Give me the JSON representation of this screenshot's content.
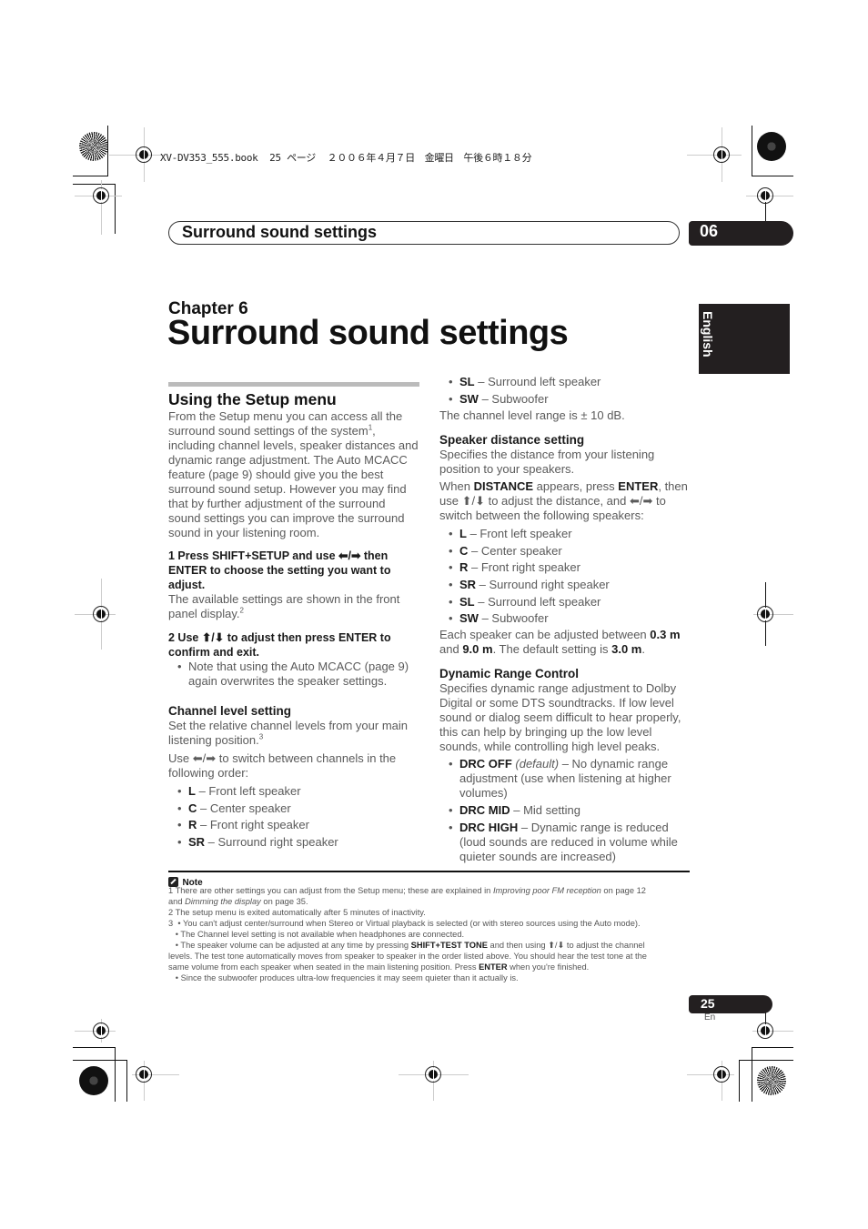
{
  "print_header": "XV-DV353_555.book  25 ページ  ２００６年４月７日　金曜日　午後６時１８分",
  "running_header": {
    "title": "Surround sound settings",
    "chapter_number": "06"
  },
  "language_tab": "English",
  "chapter": {
    "label": "Chapter 6",
    "title": "Surround sound settings"
  },
  "left_column": {
    "section_title": "Using the Setup menu",
    "intro": "From the Setup menu you can access all the surround sound settings of the system",
    "intro_sup": "1",
    "intro_cont": ", including channel levels, speaker distances and dynamic range adjustment. The Auto MCACC feature (page 9) should give you the best surround sound setup. However you may find that by further adjustment of the surround sound settings you can improve the surround sound in your listening room.",
    "step1": "1    Press SHIFT+SETUP and use ⬅/➡ then ENTER to choose the setting you want to adjust.",
    "step1_desc": "The available settings are shown in the front panel display.",
    "step1_sup": "2",
    "step2": "2    Use ⬆/⬇ to adjust then press ENTER to confirm and exit.",
    "step2_note": "Note that using the Auto MCACC (page 9) again overwrites the speaker settings.",
    "channel_heading": "Channel level setting",
    "channel_desc": "Set the relative channel levels from your main listening position.",
    "channel_sup": "3",
    "channel_use": "Use ⬅/➡ to switch between channels in the following order:",
    "channel_items": [
      {
        "code": "L",
        "desc": " – Front left speaker"
      },
      {
        "code": "C",
        "desc": " – Center speaker"
      },
      {
        "code": "R",
        "desc": " – Front right speaker"
      },
      {
        "code": "SR",
        "desc": " – Surround right speaker"
      }
    ]
  },
  "right_column": {
    "channel_items_cont": [
      {
        "code": "SL",
        "desc": " – Surround left speaker"
      },
      {
        "code": "SW",
        "desc": " – Subwoofer"
      }
    ],
    "channel_range": "The channel level range is ± 10 dB.",
    "distance_heading": "Speaker distance setting",
    "distance_desc": "Specifies the distance from your listening position to your speakers.",
    "distance_when_1": "When ",
    "distance_when_b1": "DISTANCE",
    "distance_when_2": " appears, press ",
    "distance_when_b2": "ENTER",
    "distance_when_3": ", then use ⬆/⬇ to adjust the distance, and ⬅/➡ to switch between the following speakers:",
    "distance_items": [
      {
        "code": "L",
        "desc": " – Front left speaker"
      },
      {
        "code": "C",
        "desc": " – Center speaker"
      },
      {
        "code": "R",
        "desc": " – Front right speaker"
      },
      {
        "code": "SR",
        "desc": " – Surround right speaker"
      },
      {
        "code": "SL",
        "desc": " – Surround left speaker"
      },
      {
        "code": "SW",
        "desc": " – Subwoofer"
      }
    ],
    "distance_range_1": "Each speaker can be adjusted between ",
    "distance_min": "0.3 m",
    "distance_range_2": " and ",
    "distance_max": "9.0 m",
    "distance_range_3": ". The default setting is ",
    "distance_default": "3.0 m",
    "distance_range_4": ".",
    "drc_heading": "Dynamic Range Control",
    "drc_desc": "Specifies dynamic range adjustment to Dolby Digital or some DTS soundtracks. If low level sound or dialog seem difficult to hear properly, this can help by bringing up the low level sounds, while controlling high level peaks.",
    "drc_items": [
      {
        "code": "DRC OFF",
        "italic": " (default)",
        "desc": " – No dynamic range adjustment (use when listening at higher volumes)"
      },
      {
        "code": "DRC MID",
        "italic": "",
        "desc": " – Mid setting"
      },
      {
        "code": "DRC HIGH",
        "italic": "",
        "desc": " – Dynamic range is reduced (loud sounds are reduced in volume while quieter sounds are increased)"
      }
    ]
  },
  "note": {
    "label": "Note",
    "fn1_a": "1 There are other settings you can adjust from the Setup menu; these are explained in ",
    "fn1_i1": "Improving poor FM reception",
    "fn1_b": " on page 12",
    "fn1_c": "and ",
    "fn1_i2": "Dimming the display",
    "fn1_d": " on page 35.",
    "fn2": "2 The setup menu is exited automatically after 5 minutes of inactivity.",
    "fn3_a": "3  • You can't adjust center/surround when Stereo or Virtual playback is selected (or with stereo sources using the Auto mode).",
    "fn3_b": "   • The Channel level setting is not available when headphones are connected.",
    "fn3_c1": "   • The speaker volume can be adjusted at any time by pressing ",
    "fn3_c_b": "SHIFT+TEST TONE",
    "fn3_c2": " and then using ⬆/⬇ to adjust the channel",
    "fn3_d": "levels. The test tone automatically moves from speaker to speaker in the order listed above. You should hear the test tone at the",
    "fn3_e1": "same volume from each speaker when seated in the main listening position. Press ",
    "fn3_e_b": "ENTER",
    "fn3_e2": " when you're finished.",
    "fn3_f": "   • Since the subwoofer produces ultra-low frequencies it may seem quieter than it actually is."
  },
  "page": {
    "number": "25",
    "lang": "En"
  }
}
